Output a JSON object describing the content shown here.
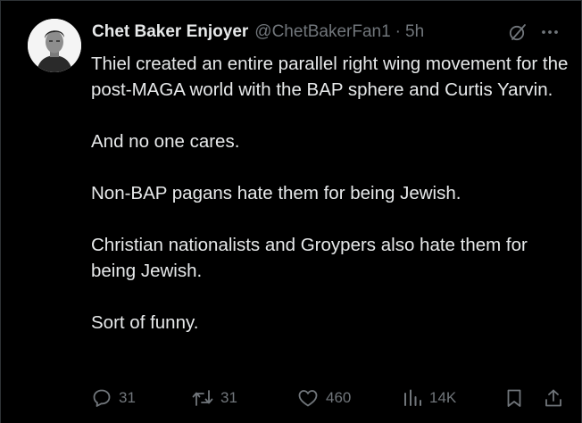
{
  "tweet": {
    "display_name": "Chet Baker Enjoyer",
    "handle": "@ChetBakerFan1",
    "separator": "·",
    "time": "5h",
    "paragraphs": [
      "Thiel created an entire parallel right wing movement for the post-MAGA world with the BAP sphere and Curtis Yarvin.",
      "And no one cares.",
      "Non-BAP pagans hate them for being Jewish.",
      "Christian nationalists and Groypers also hate them for being Jewish.",
      "Sort of funny."
    ]
  },
  "header_icons": [
    "grok-icon",
    "more-icon"
  ],
  "actions": {
    "reply": {
      "icon": "reply-icon",
      "count": "31"
    },
    "retweet": {
      "icon": "retweet-icon",
      "count": "31"
    },
    "like": {
      "icon": "heart-icon",
      "count": "460"
    },
    "views": {
      "icon": "views-icon",
      "count": "14K"
    },
    "bookmark": {
      "icon": "bookmark-icon"
    },
    "share": {
      "icon": "share-icon"
    }
  },
  "colors": {
    "background": "#000000",
    "text": "#e7e9ea",
    "secondary": "#71767b"
  }
}
